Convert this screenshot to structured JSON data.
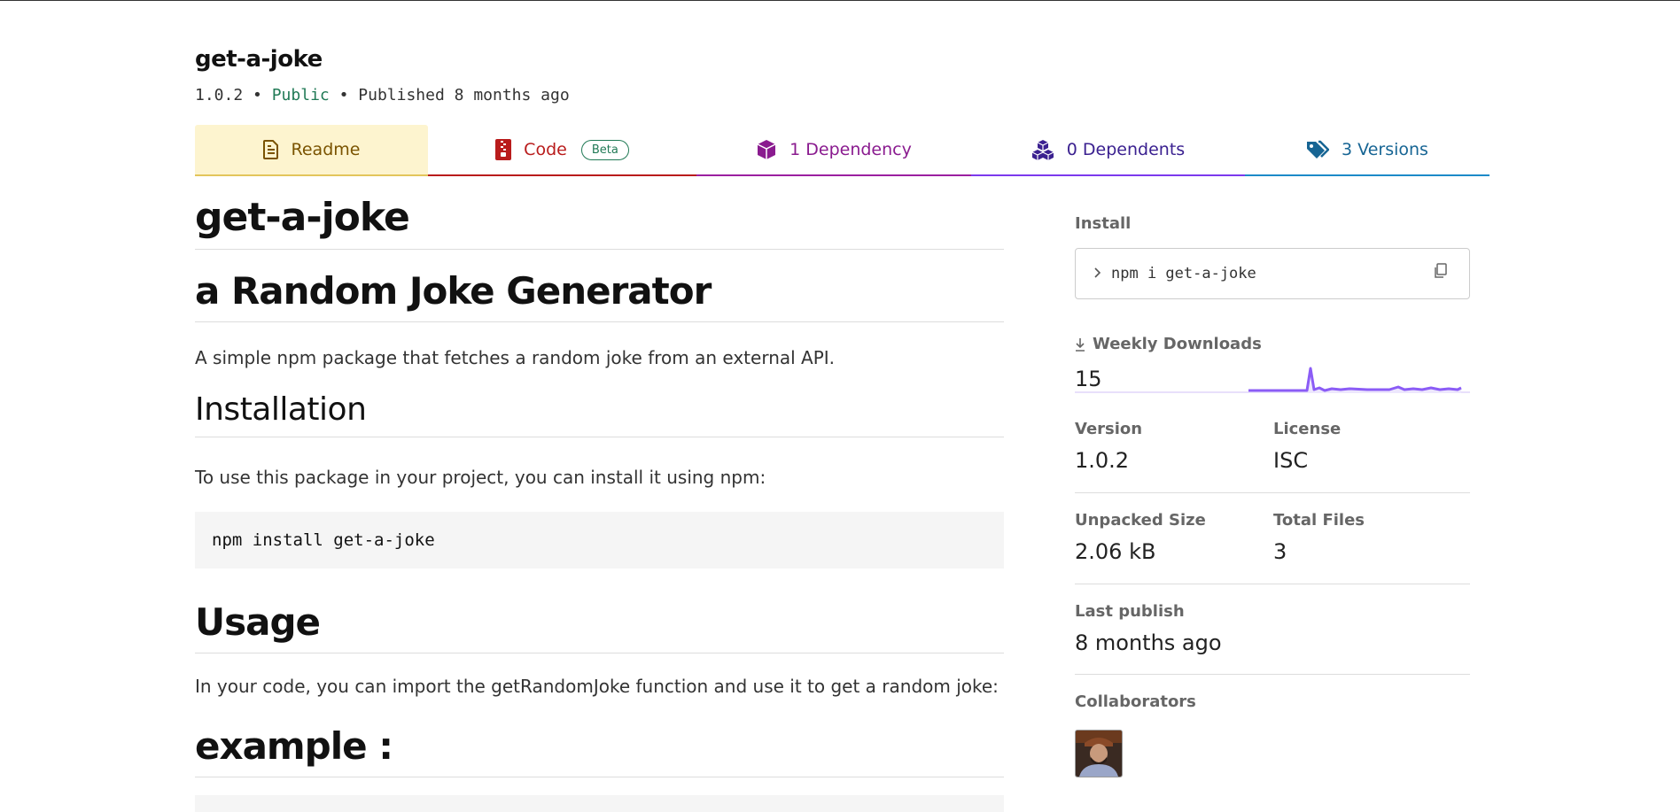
{
  "package": {
    "name": "get-a-joke",
    "version": "1.0.2",
    "sep": "•",
    "visibility": "Public",
    "published": "Published 8 months ago"
  },
  "tabs": {
    "readme": "Readme",
    "code": "Code",
    "beta": "Beta",
    "dependency": "1 Dependency",
    "dependents": "0 Dependents",
    "versions": "3 Versions"
  },
  "readme": {
    "title": "get-a-joke",
    "subtitle": "a Random Joke Generator",
    "intro": "A simple npm package that fetches a random joke from an external API.",
    "installation_heading": "Installation",
    "installation_text": "To use this package in your project, you can install it using npm:",
    "install_code": "npm install get-a-joke",
    "usage_heading": "Usage",
    "usage_text": "In your code, you can import the getRandomJoke function and use it to get a random joke:",
    "example_heading": "example :"
  },
  "sidebar": {
    "install_label": "Install",
    "install_command": "npm i get-a-joke",
    "weekly_downloads_label": "Weekly Downloads",
    "weekly_downloads": "15",
    "version_label": "Version",
    "version": "1.0.2",
    "license_label": "License",
    "license": "ISC",
    "unpacked_size_label": "Unpacked Size",
    "unpacked_size": "2.06 kB",
    "total_files_label": "Total Files",
    "total_files": "3",
    "last_publish_label": "Last publish",
    "last_publish": "8 months ago",
    "collaborators_label": "Collaborators"
  },
  "sparkline_color": "#8b5cf6",
  "icons": {
    "readme": "document-icon",
    "code": "zip-file-icon",
    "dependency": "box-icon",
    "dependents": "boxes-icon",
    "versions": "tags-icon",
    "copy": "copy-icon",
    "download": "download-arrow-icon"
  }
}
